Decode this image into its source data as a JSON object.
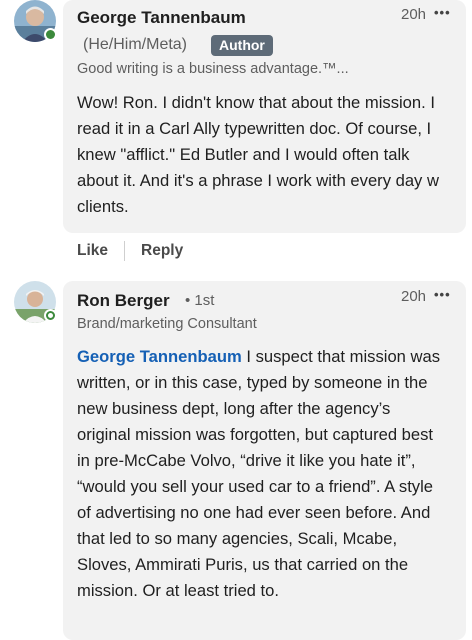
{
  "comments": [
    {
      "author": "George Tannenbaum",
      "pronouns": "(He/Him/Meta)",
      "badge": "Author",
      "headline": "Good writing is a business advantage.™...",
      "time": "20h",
      "more_glyph": "•••",
      "text": "Wow! Ron. I didn't know that about the mission. I read it in a Carl Ally typewritten doc. Of course, I knew \"afflict.\" Ed Butler and I would often talk about it. And it's a phrase I work with every day w clients.",
      "actions": {
        "like": "Like",
        "reply": "Reply"
      }
    },
    {
      "author": "Ron Berger",
      "degree": "• 1st",
      "headline": "Brand/marketing Consultant",
      "time": "20h",
      "more_glyph": "•••",
      "mention": "George Tannenbaum",
      "text": " I suspect that mission was written, or in this case, typed by someone in the new business dept, long after the agency’s original mission was forgotten, but captured best in pre-McCabe Volvo, “drive it like you hate it”, “would you sell your used car to a friend”. A style of advertising no one had ever seen before. And that led to so many agencies, Scali, Mcabe, Sloves, Ammirati Puris, us that carried on the mission. Or at least tried to."
    }
  ],
  "colors": {
    "bubble": "#f2f2f2",
    "mention": "#1560b5",
    "badge": "#5e6b78",
    "online": "#3c8a3c"
  }
}
